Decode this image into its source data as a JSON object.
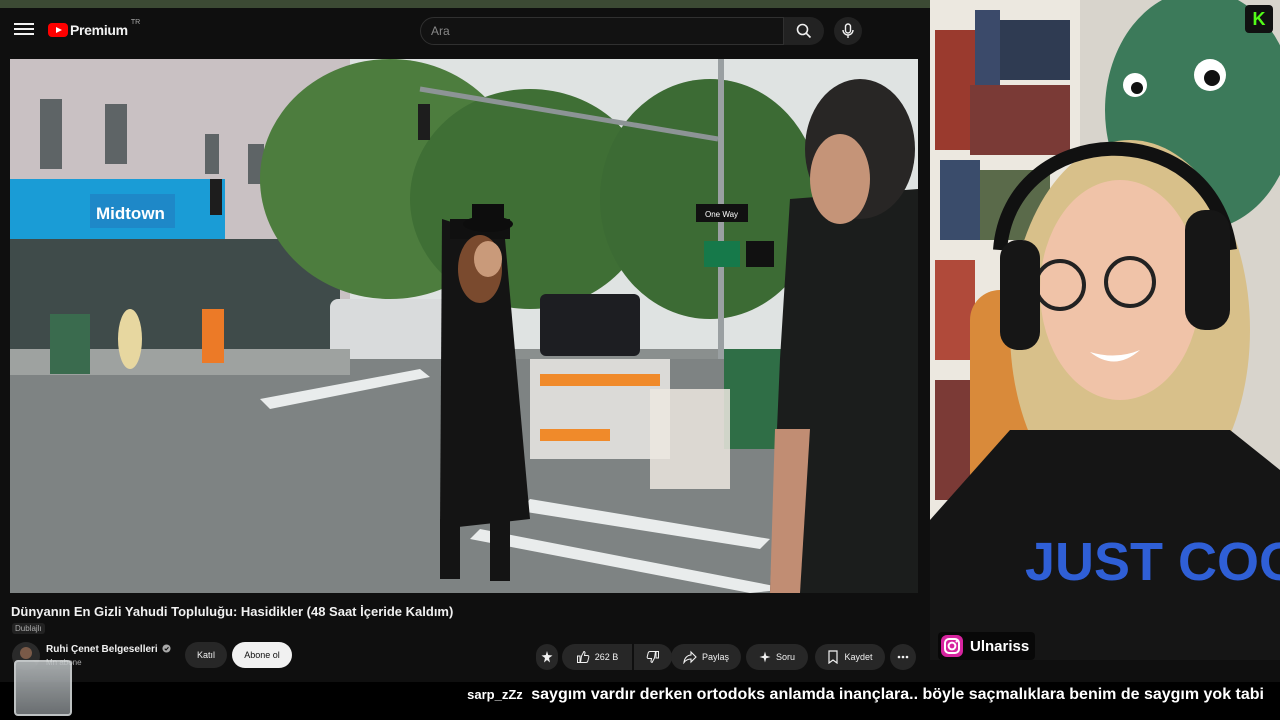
{
  "app": {
    "logo_text": "Premium",
    "logo_region": "TR"
  },
  "search": {
    "placeholder": "Ara",
    "value": ""
  },
  "video": {
    "title": "Dünyanın En Gizli Yahudi Topluluğu: Hasidikler (48 Saat İçeride Kaldım)",
    "dubbed_label": "Dublajlı",
    "street_sign": "One Way",
    "store_sign": "Midtown"
  },
  "channel": {
    "name": "Ruhi Çenet Belgeselleri",
    "subs": "Mn abone",
    "verified": true
  },
  "actions": {
    "join": "Katıl",
    "subscribe": "Abone ol",
    "likes": "262 B",
    "share": "Paylaş",
    "ask": "Soru",
    "save": "Kaydet"
  },
  "streamer": {
    "instagram": "Ulnariss",
    "platform_badge": "K",
    "shirt_text": "JUST COOL"
  },
  "chat": {
    "user": "sarp_zZz",
    "message": "saygım vardır derken ortodoks anlamda inançlara.. böyle saçmalıklara benim de saygım yok tabi"
  },
  "colors": {
    "youtube_red": "#ff0000",
    "kick_green": "#53fc18",
    "background": "#0f0f0f"
  }
}
